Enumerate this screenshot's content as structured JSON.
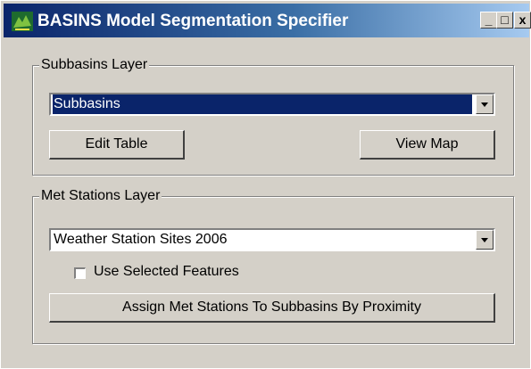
{
  "window": {
    "title": "BASINS Model Segmentation Specifier",
    "minimize_label": "_",
    "maximize_label": "□",
    "close_label": "x"
  },
  "subbasins_group": {
    "legend": "Subbasins Layer",
    "layer_select": {
      "value": "Subbasins"
    },
    "edit_table_label": "Edit Table",
    "view_map_label": "View Map"
  },
  "met_group": {
    "legend": "Met Stations Layer",
    "layer_select": {
      "value": "Weather Station Sites 2006"
    },
    "use_selected_label": "Use Selected Features",
    "use_selected_checked": false,
    "assign_label": "Assign Met Stations To Subbasins By Proximity"
  }
}
